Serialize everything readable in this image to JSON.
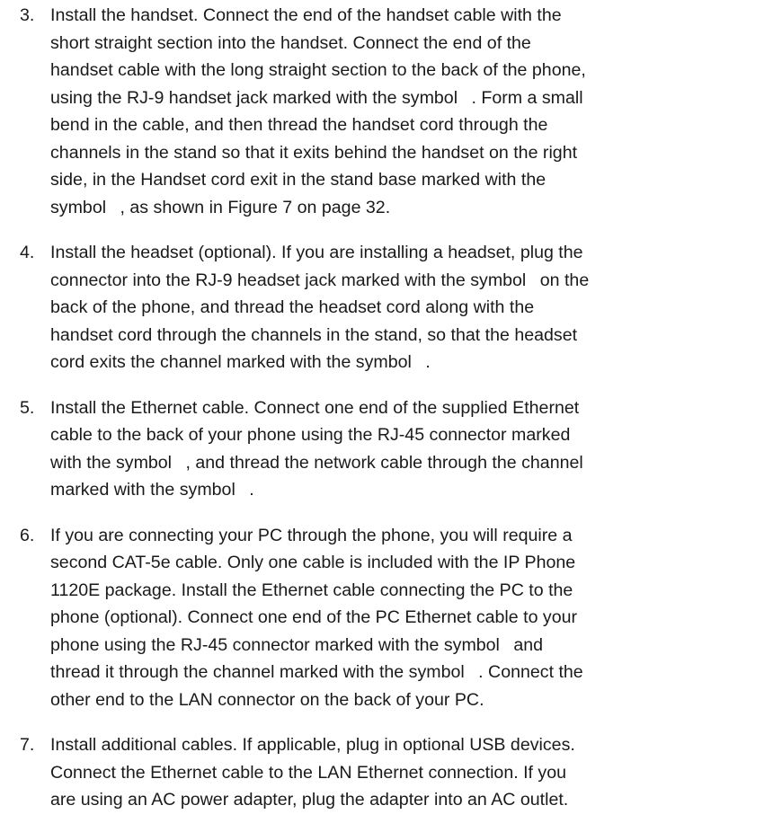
{
  "steps": [
    {
      "number": "3.",
      "lines": [
        "Install the handset. Connect the end of the handset cable with the",
        "short straight section into the handset. Connect the end of the",
        "handset cable with the long straight section to the back of the phone,",
        [
          "using the RJ-9 handset jack marked with the symbol ",
          ". Form a small"
        ],
        "bend in the cable, and then thread the handset cord through the",
        "channels in the stand so that it exits behind the handset on the right",
        "side, in the Handset cord exit in the stand base marked with the",
        [
          "symbol ",
          ", as shown in Figure 7 on page 32."
        ]
      ]
    },
    {
      "number": "4.",
      "lines": [
        "Install the headset (optional). If you are installing a headset, plug the",
        [
          "connector into the RJ-9 headset jack marked with the symbol ",
          "on the"
        ],
        "back of the phone, and thread the headset cord along with the",
        "handset cord through the channels in the stand, so that the headset",
        [
          "cord exits the channel marked with the symbol ",
          "."
        ]
      ]
    },
    {
      "number": "5.",
      "lines": [
        "Install the Ethernet cable. Connect one end of the supplied Ethernet",
        "cable to the back of your phone using the RJ-45 connector marked",
        [
          "with the symbol ",
          ", and thread the network cable through the channel"
        ],
        [
          "marked with the symbol ",
          "."
        ]
      ]
    },
    {
      "number": "6.",
      "lines": [
        "If you are connecting your PC through the phone, you will require a",
        "second CAT-5e cable. Only one cable is included with the IP Phone",
        "1120E package. Install the Ethernet cable connecting the PC to the",
        "phone (optional). Connect one end of the PC Ethernet cable to your",
        [
          "phone using the RJ-45 connector marked with the symbol ",
          "and"
        ],
        [
          "thread it through the channel marked with the symbol ",
          ". Connect the"
        ],
        "other end to the LAN connector on the back of your PC."
      ]
    },
    {
      "number": "7.",
      "lines": [
        "Install additional cables. If applicable, plug in optional USB devices.",
        "Connect the Ethernet cable to the LAN Ethernet connection. If you",
        "are using an AC power adapter, plug the adapter into an AC outlet."
      ]
    }
  ]
}
